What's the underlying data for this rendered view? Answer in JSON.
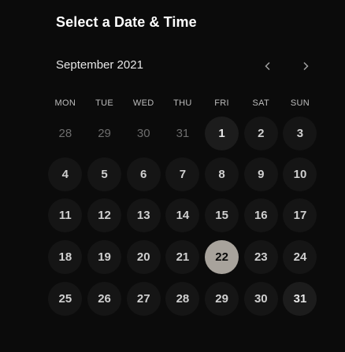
{
  "header": {
    "title": "Select a Date & Time"
  },
  "calendar": {
    "month_label": "September 2021",
    "prev_icon": "chevron-left-icon",
    "next_icon": "chevron-right-icon",
    "weekdays": [
      "MON",
      "TUE",
      "WED",
      "THU",
      "FRI",
      "SAT",
      "SUN"
    ],
    "weeks": [
      [
        "28",
        "29",
        "30",
        "31",
        "1",
        "2",
        "3"
      ],
      [
        "4",
        "5",
        "6",
        "7",
        "8",
        "9",
        "10"
      ],
      [
        "11",
        "12",
        "13",
        "14",
        "15",
        "16",
        "17"
      ],
      [
        "18",
        "19",
        "20",
        "21",
        "22",
        "23",
        "24"
      ],
      [
        "25",
        "26",
        "27",
        "28",
        "29",
        "30",
        "31"
      ]
    ],
    "selected_day": "22"
  },
  "colors": {
    "background": "#0b0b0b",
    "day_circle": "#151515",
    "available_circle": "#1c1c1c",
    "selected_circle": "#a8a39c"
  }
}
